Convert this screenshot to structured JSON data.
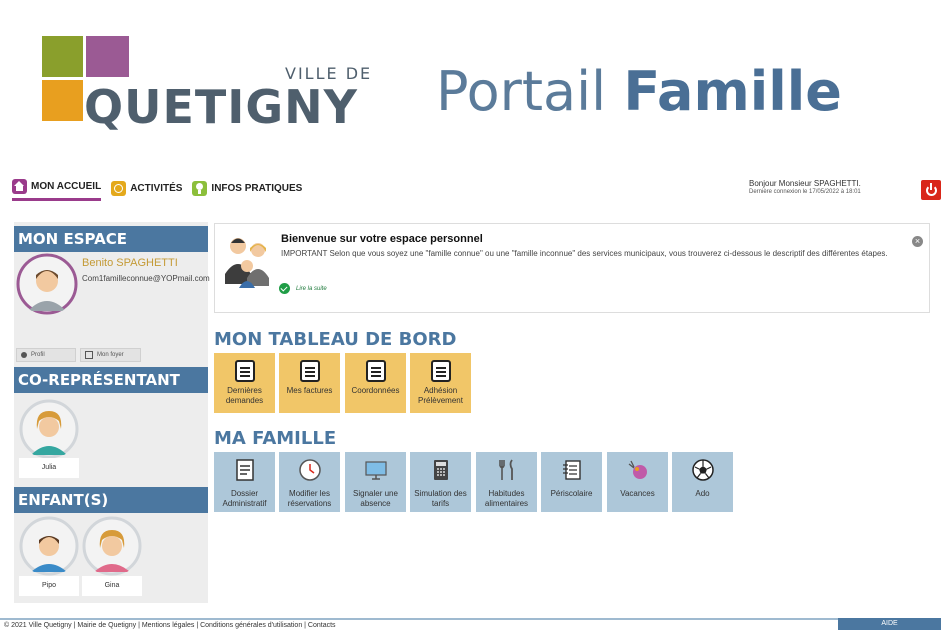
{
  "header": {
    "logo_ville": "VILLE DE",
    "logo_city": "QUETIGNY",
    "portal_prefix": "Portail",
    "portal_bold": "Famille",
    "colors": {
      "green": "#8a9f2c",
      "purple": "#9b5a94",
      "orange": "#e89f1f",
      "slate": "#4f5f6d"
    }
  },
  "nav": {
    "items": [
      {
        "label": "MON ACCUEIL",
        "icon": "home-icon",
        "active": true
      },
      {
        "label": "ACTIVITÉS",
        "icon": "clock-icon",
        "active": false
      },
      {
        "label": "INFOS PRATIQUES",
        "icon": "info-icon",
        "active": false
      }
    ],
    "greeting": "Bonjour Monsieur SPAGHETTI.",
    "last_login": "Dernière connexion le 17/05/2022 à 18:01"
  },
  "sidebar": {
    "espace_title": "MON ESPACE",
    "user_name": "Benito SPAGHETTI",
    "user_email": "Com1familleconnue@YOPmail.com",
    "profile_label": "Profil",
    "foyer_label": "Mon foyer",
    "corep_title": "CO-REPRÉSENTANT",
    "corep_name": "Julia",
    "enfants_title": "ENFANT(S)",
    "children": [
      "Pipo",
      "Gina"
    ]
  },
  "welcome": {
    "title": "Bienvenue sur votre espace personnel",
    "text": "IMPORTANT Selon que vous soyez une \"famille connue\" ou une \"famille inconnue\" des services municipaux, vous trouverez ci-dessous le descriptif des différentes étapes.",
    "readmore": "Lire la suite"
  },
  "dashboard": {
    "title": "MON TABLEAU DE BORD",
    "tiles": [
      "Dernières demandes",
      "Mes factures",
      "Coordonnées",
      "Adhésion Prélèvement"
    ]
  },
  "family": {
    "title": "MA FAMILLE",
    "tiles": [
      "Dossier Administratif",
      "Modifier les réservations",
      "Signaler une absence",
      "Simulation des tarifs",
      "Habitudes alimentaires",
      "Périscolaire",
      "Vacances",
      "Ado"
    ]
  },
  "footer": {
    "text": "© 2021 Ville Quetigny | Mairie de Quetigny | Mentions légales | Conditions générales d'utilisation | Contacts",
    "aide": "AIDE"
  }
}
